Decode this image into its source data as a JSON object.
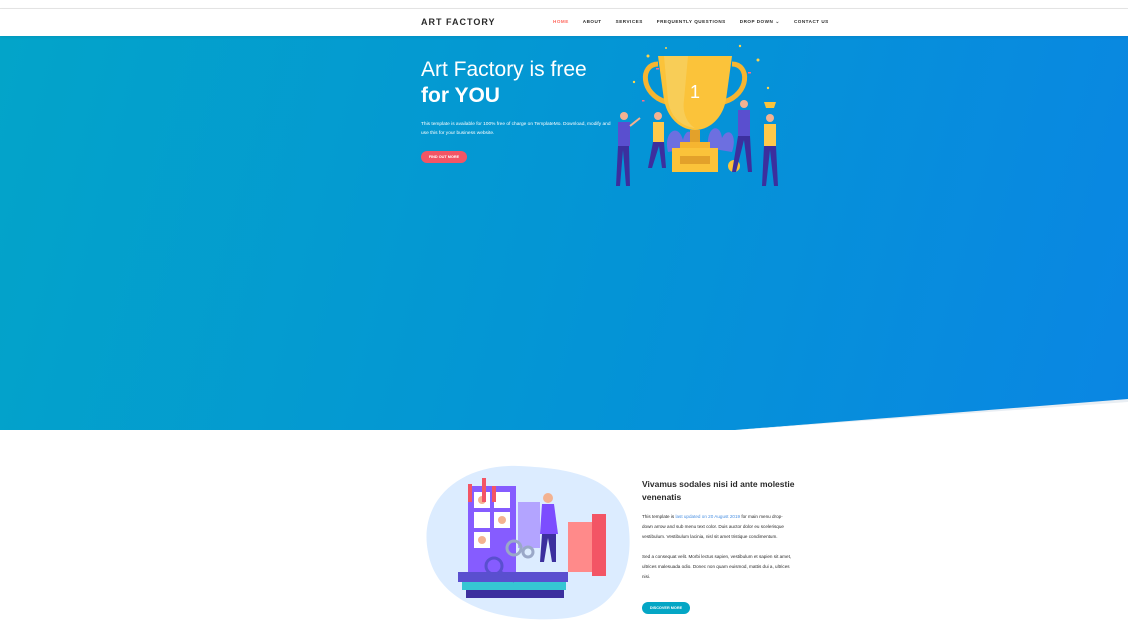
{
  "header": {
    "logo": "ART FACTORY",
    "nav": [
      {
        "label": "HOME",
        "active": true
      },
      {
        "label": "ABOUT"
      },
      {
        "label": "SERVICES"
      },
      {
        "label": "FREQUENTLY QUESTIONS"
      },
      {
        "label": "DROP DOWN"
      },
      {
        "label": "CONTACT US"
      }
    ]
  },
  "hero": {
    "title_line1": "Art Factory is free",
    "title_line2": "for YOU",
    "text": "This template is available for 100% free of charge on TemplateMo. Download, modify and use this for your business website.",
    "button": "FIND OUT MORE",
    "trophy_number": "1"
  },
  "about": {
    "title": "Vivamus sodales nisi id ante molestie venenatis",
    "p1_before": "This template is ",
    "p1_link": "last updated on 20 August 2019",
    "p1_after": " for main menu drop-down arrow and sub menu text color. Duis auctor dolor eu scelerisque vestibulum. Vestibulum lacinia, nisl sit amet tristique condimentum.",
    "p2": "Sed a consequat velit. Morbi lectus sapien, vestibulum et sapien sit amet, ultrices malesuada odio. Donec non quam euismod, mattis dui a, ultrices nisi.",
    "button": "DISCOVER MORE"
  },
  "colors": {
    "accent_red": "#f35565",
    "accent_teal": "#04a6c5",
    "hero_start": "#03a4c9",
    "hero_end": "#0a86e3"
  }
}
